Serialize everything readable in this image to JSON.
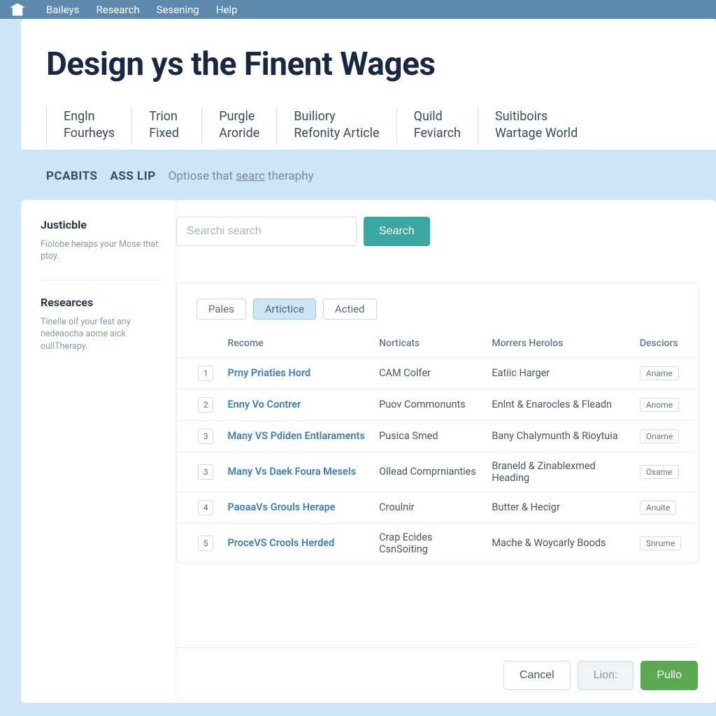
{
  "topnav": {
    "items": [
      "Baileys",
      "Research",
      "Sesening",
      "Help"
    ]
  },
  "card": {
    "title": "Design ys the Finent Wages",
    "tabs": [
      {
        "l1": "Engln",
        "l2": "Fourheys"
      },
      {
        "l1": "Trion",
        "l2": "Fixed"
      },
      {
        "l1": "Purgle",
        "l2": "Aroride"
      },
      {
        "l1": "Builiory",
        "l2": "Refonity Article"
      },
      {
        "l1": "Quild",
        "l2": "Feviarch"
      },
      {
        "l1": "Suitiboirs",
        "l2": "Wartage World"
      }
    ]
  },
  "subtabs": {
    "a": "PCABITS",
    "b": "ASS LIP",
    "hint_pre": "Optiose that ",
    "hint_u": "searc",
    "hint_post": " theraphy"
  },
  "sidebar": {
    "s1_title": "Justicble",
    "s1_body": "Fíolobe heraps your Mose that ptoy.",
    "s2_title": "Researces",
    "s2_body": "Tinelle oíf your fest any nedeaocha aome aick oullTherapy."
  },
  "search": {
    "placeholder": "Searchi search",
    "button": "Search"
  },
  "pills": [
    "Pales",
    "Artictice",
    "Actied"
  ],
  "table": {
    "headers": [
      "",
      "Recome",
      "Norticats",
      "Morrers Herolos",
      "Desciors"
    ],
    "rows": [
      {
        "n": "1",
        "a": "Prny Priaties Hord",
        "b": "CAM Colfer",
        "c": "Eatiic Harger",
        "d": "Aname"
      },
      {
        "n": "2",
        "a": "Enny Vo Contrer",
        "b": "Puov Commonunts",
        "c": "Enlnt & Enarocles & Fleadn",
        "d": "Anome"
      },
      {
        "n": "3",
        "a": "Many VS Pdiden Entlaraments",
        "b": "Pusica Smed",
        "c": "Bany Chalymunth & Rioytuia",
        "d": "Oname"
      },
      {
        "n": "3",
        "a": "Many Vs Daek Foura Mesels",
        "b": "Ollead Comprnianties",
        "c": "Braneld & Zinablexmed Heading",
        "d": "Oxame"
      },
      {
        "n": "4",
        "a": "PaoaaVs Grouls Herape",
        "b": "Croulnir",
        "c": "Butter & Hecigr",
        "d": "Anuite"
      },
      {
        "n": "5",
        "a": "ProceVS Crools Herded",
        "b": "Crap Ecides CsnSoiting",
        "c": "Mache & Woycarly Boods",
        "d": "Snrume"
      }
    ]
  },
  "footer": {
    "cancel": "Cancel",
    "lion": "Lion:",
    "publo": "Pullo"
  }
}
